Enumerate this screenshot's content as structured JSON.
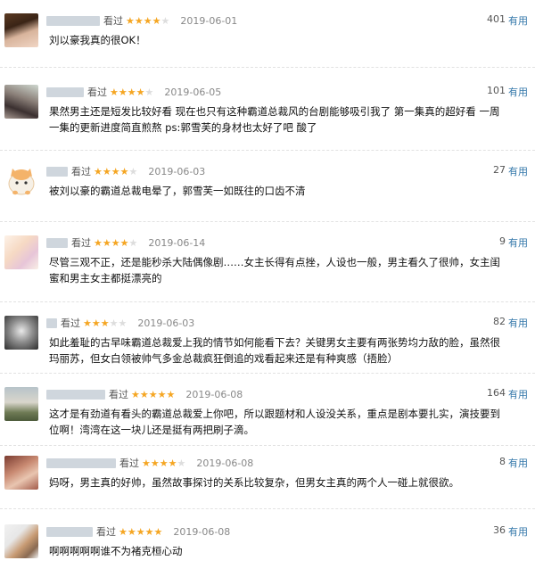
{
  "reviews": [
    {
      "seen": "看过",
      "stars": 4,
      "date": "2019-06-01",
      "votes": "401",
      "useful": "有用",
      "text": "刘以豪我真的很OK！"
    },
    {
      "seen": "看过",
      "stars": 4,
      "date": "2019-06-05",
      "votes": "101",
      "useful": "有用",
      "text": "果然男主还是短发比较好看 现在也只有这种霸道总裁风的台剧能够吸引我了 第一集真的超好看 一周一集的更新进度简直煎熬 ps:郭雪芙的身材也太好了吧 酸了"
    },
    {
      "seen": "看过",
      "stars": 4,
      "date": "2019-06-03",
      "votes": "27",
      "useful": "有用",
      "text": "被刘以豪的霸道总裁电晕了，郭雪芙一如既往的口齿不清"
    },
    {
      "seen": "看过",
      "stars": 4,
      "date": "2019-06-14",
      "votes": "9",
      "useful": "有用",
      "text": "尽管三观不正，还是能秒杀大陆偶像剧……女主长得有点挫，人设也一般，男主看久了很帅，女主闺蜜和男主女主都挺漂亮的"
    },
    {
      "seen": "看过",
      "stars": 3,
      "date": "2019-06-03",
      "votes": "82",
      "useful": "有用",
      "text": "如此羞耻的古早味霸道总裁爱上我的情节如何能看下去？关键男女主要有两张势均力敌的脸，虽然很玛丽苏，但女白领被帅气多金总裁疯狂倒追的戏看起来还是有种爽感（捂脸）"
    },
    {
      "seen": "看过",
      "stars": 5,
      "date": "2019-06-08",
      "votes": "164",
      "useful": "有用",
      "text": "这才是有劲道有看头的霸道总裁爱上你吧，所以跟题材和人设没关系，重点是剧本要扎实，演技要到位啊！湾湾在这一块儿还是挺有两把刷子滴。"
    },
    {
      "seen": "看过",
      "stars": 4,
      "date": "2019-06-08",
      "votes": "8",
      "useful": "有用",
      "text": "妈呀，男主真的好帅，虽然故事探讨的关系比较复杂，但男女主真的两个人一碰上就很欲。"
    },
    {
      "seen": "看过",
      "stars": 5,
      "date": "2019-06-08",
      "votes": "36",
      "useful": "有用",
      "text": "啊啊啊啊啊谁不为褚克桓心动"
    }
  ],
  "colors": {
    "star": "#f5a623",
    "star_off": "#dddddd",
    "link": "#3377aa"
  }
}
